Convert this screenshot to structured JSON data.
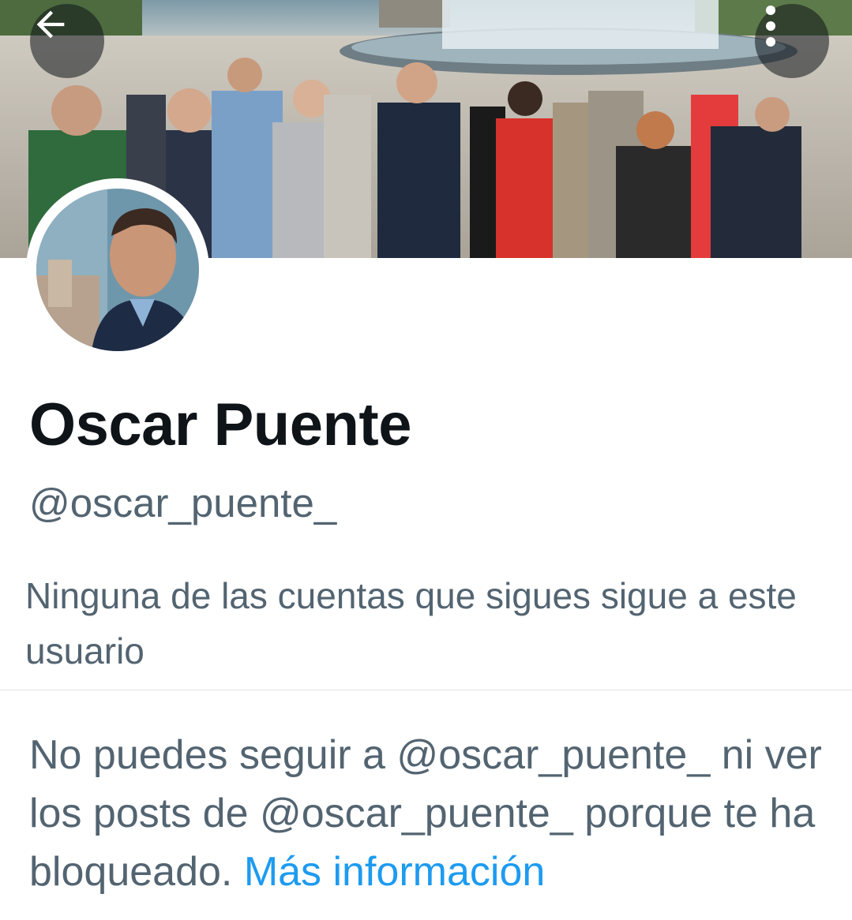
{
  "header": {
    "banner_alt": "Group photo banner",
    "back_icon": "arrow-left-icon",
    "more_icon": "more-vertical-icon"
  },
  "profile": {
    "display_name": "Oscar Puente",
    "handle": "@oscar_puente_",
    "followers_note": "Ninguna de las cuentas que sigues sigue a este usuario"
  },
  "blocked": {
    "message": "No puedes seguir a @oscar_puente_ ni ver los posts de @oscar_puente_ porque te ha bloqueado.",
    "link_label": "Más información"
  },
  "colors": {
    "primary_text": "#0f1419",
    "secondary_text": "#536471",
    "link": "#1d9bf0",
    "divider": "#dfe3e6"
  }
}
